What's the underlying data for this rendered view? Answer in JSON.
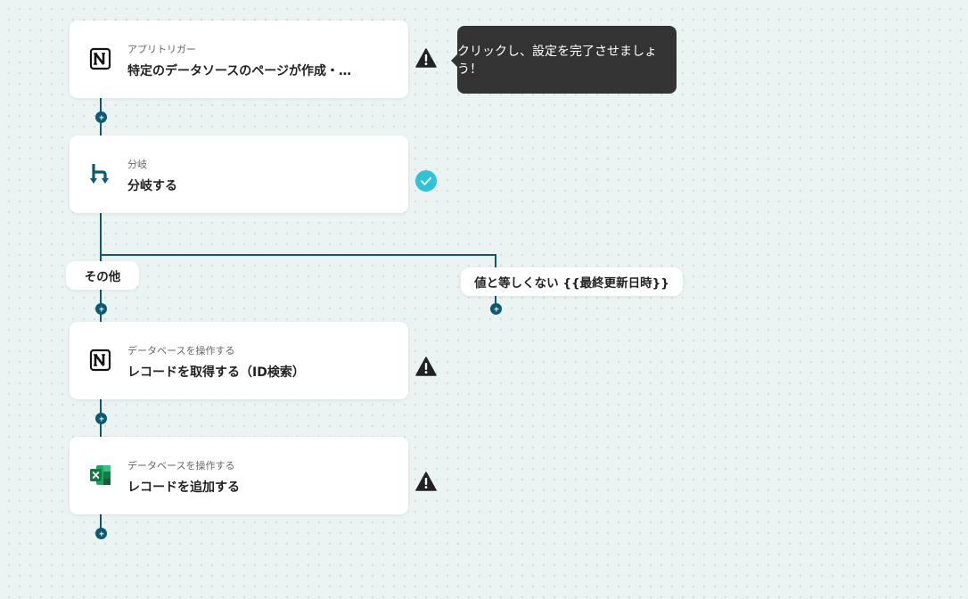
{
  "steps": [
    {
      "sub": "アプリトリガー",
      "title": "特定のデータソースのページが作成・…",
      "icon": "notion-icon",
      "status": "warning"
    },
    {
      "sub": "分岐",
      "title": "分岐する",
      "icon": "branch-icon",
      "status": "complete"
    },
    {
      "sub": "データベースを操作する",
      "title": "レコードを取得する（ID検索）",
      "icon": "notion-icon",
      "status": "warning"
    },
    {
      "sub": "データベースを操作する",
      "title": "レコードを追加する",
      "icon": "excel-icon",
      "status": "warning"
    }
  ],
  "tooltip": {
    "text": "クリックし、設定を完了させましょう！"
  },
  "branches": {
    "other_label": "その他",
    "condition_label": "値と等しくない {{最終更新日時}}"
  },
  "colors": {
    "line": "#0c5a72",
    "branch_icon": "#0c5a72",
    "complete": "#2ec3d6",
    "warning": "#222222",
    "tooltip_bg": "#333333",
    "excel_green": "#107c41"
  }
}
